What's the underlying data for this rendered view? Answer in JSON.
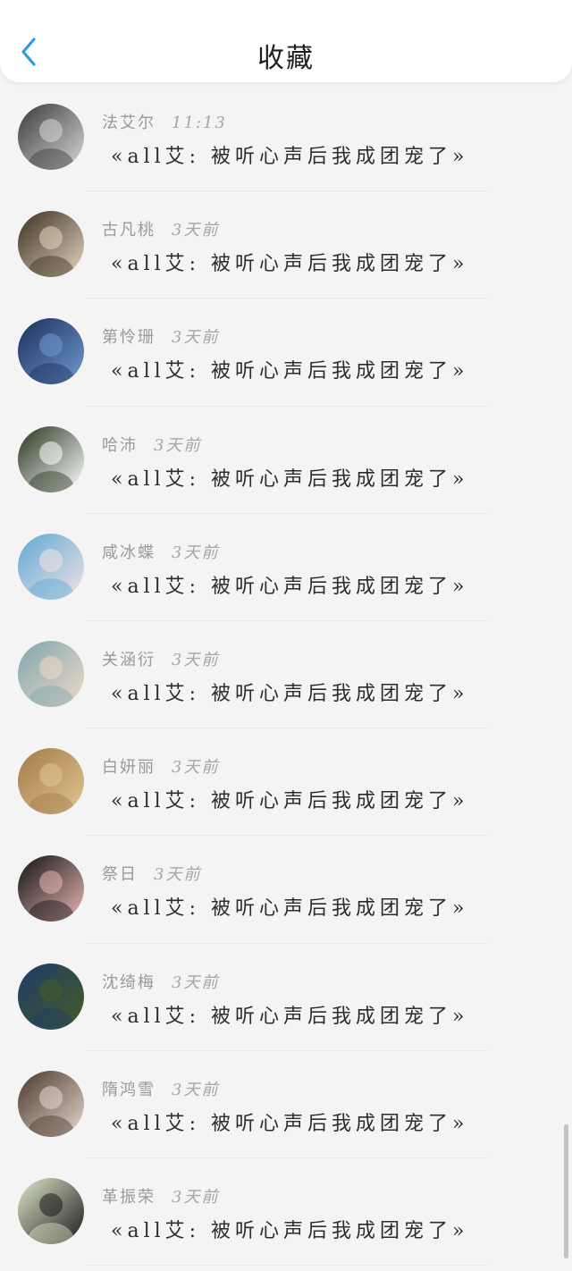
{
  "header": {
    "title": "收藏",
    "back_icon": "chevron-left-icon",
    "accent": "#2d9ce0"
  },
  "items": [
    {
      "name": "法艾尔",
      "time": "11:13",
      "message": "«all艾: 被听心声后我成团宠了»",
      "avatar_colors": [
        "#3a3a3a",
        "#d8d8d8"
      ]
    },
    {
      "name": "古凡桃",
      "time": "3天前",
      "message": "«all艾: 被听心声后我成团宠了»",
      "avatar_colors": [
        "#3b2e22",
        "#e4d6be"
      ]
    },
    {
      "name": "第怜珊",
      "time": "3天前",
      "message": "«all艾: 被听心声后我成团宠了»",
      "avatar_colors": [
        "#1b2e5a",
        "#6f9ad0"
      ]
    },
    {
      "name": "哈沛",
      "time": "3天前",
      "message": "«all艾: 被听心声后我成团宠了»",
      "avatar_colors": [
        "#26351e",
        "#ffffff"
      ]
    },
    {
      "name": "咸冰蝶",
      "time": "3天前",
      "message": "«all艾: 被听心声后我成团宠了»",
      "avatar_colors": [
        "#5fa9d6",
        "#f1e3e3"
      ]
    },
    {
      "name": "关涵衍",
      "time": "3天前",
      "message": "«all艾: 被听心声后我成团宠了»",
      "avatar_colors": [
        "#7fa6b0",
        "#efd9c6"
      ]
    },
    {
      "name": "白妍丽",
      "time": "3天前",
      "message": "«all艾: 被听心声后我成团宠了»",
      "avatar_colors": [
        "#a27a48",
        "#e3c594"
      ]
    },
    {
      "name": "祭日",
      "time": "3天前",
      "message": "«all艾: 被听心声后我成团宠了»",
      "avatar_colors": [
        "#111111",
        "#e8b7b5"
      ]
    },
    {
      "name": "沈绮梅",
      "time": "3天前",
      "message": "«all艾: 被听心声后我成团宠了»",
      "avatar_colors": [
        "#1d3b6a",
        "#465c25"
      ]
    },
    {
      "name": "隋鸿雪",
      "time": "3天前",
      "message": "«all艾: 被听心声后我成团宠了»",
      "avatar_colors": [
        "#4a372c",
        "#e5d8cf"
      ]
    },
    {
      "name": "革振荣",
      "time": "3天前",
      "message": "«all艾: 被听心声后我成团宠了»",
      "avatar_colors": [
        "#dfe7c9",
        "#1a1a1a"
      ]
    }
  ]
}
